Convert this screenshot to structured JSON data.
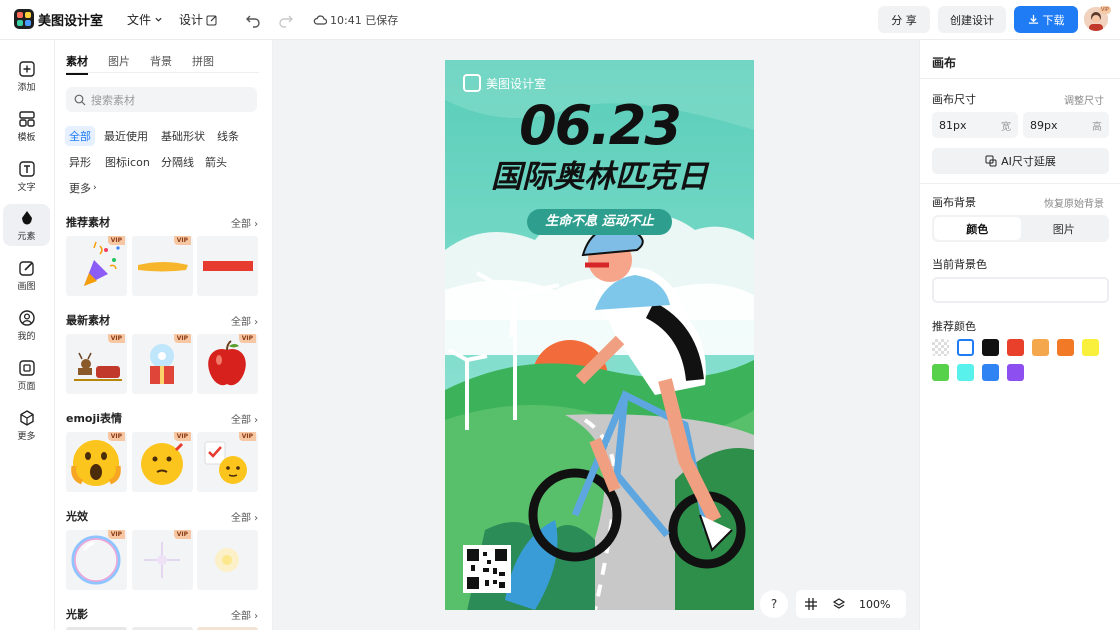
{
  "app": {
    "title": "美图设计室"
  },
  "topbar": {
    "file_menu": "文件",
    "design_menu": "设计",
    "save_status": "10:41 已保存",
    "share": "分 享",
    "create_design": "创建设计",
    "download": "下载",
    "avatar_badge": "VIP"
  },
  "leftnav": {
    "items": [
      {
        "label": "添加",
        "icon": "plus-square-icon"
      },
      {
        "label": "模板",
        "icon": "template-icon"
      },
      {
        "label": "文字",
        "icon": "text-icon"
      },
      {
        "label": "元素",
        "icon": "shapes-icon"
      },
      {
        "label": "画图",
        "icon": "pencil-icon"
      },
      {
        "label": "我的",
        "icon": "user-icon"
      },
      {
        "label": "页面",
        "icon": "page-add-icon"
      },
      {
        "label": "更多",
        "icon": "cube-icon"
      }
    ]
  },
  "panel": {
    "tabs": [
      "素材",
      "图片",
      "背景",
      "拼图"
    ],
    "search_placeholder": "搜索素材",
    "chips": [
      "全部",
      "最近使用",
      "基础形状",
      "线条",
      "异形",
      "图标icon",
      "分隔线",
      "箭头",
      "更多"
    ],
    "sections": [
      {
        "title": "推荐素材",
        "all": "全部"
      },
      {
        "title": "最新素材",
        "all": "全部"
      },
      {
        "title": "emoji表情",
        "all": "全部"
      },
      {
        "title": "光效",
        "all": "全部"
      },
      {
        "title": "光影",
        "all": "全部"
      }
    ],
    "vip": "VIP"
  },
  "canvas": {
    "brand": "美图设计室",
    "date": "06.23",
    "headline": "国际奥林匹克日",
    "slogan": "生命不息 运动不止",
    "colors": {
      "sky": "#6fd3c1",
      "grass": "#3cb35a",
      "sun": "#f0633a"
    }
  },
  "zoom": {
    "help": "?",
    "level": "100%"
  },
  "rpanel": {
    "title": "画布",
    "size_label": "画布尺寸",
    "size_link": "调整尺寸",
    "width_value": "81px",
    "width_unit": "宽",
    "height_value": "89px",
    "height_unit": "高",
    "ai_extend": "AI尺寸延展",
    "bg_label": "画布背景",
    "bg_reset": "恢复原始背景",
    "seg_color": "颜色",
    "seg_image": "图片",
    "current_bg": "当前背景色",
    "recommended": "推荐颜色",
    "swatches": [
      "transparent",
      "#ffffff",
      "#111111",
      "#e8402a",
      "#f4a74c",
      "#f27a26",
      "#f8f03c",
      "#58d14a",
      "#58f1ec",
      "#2f83f3",
      "#8e4ff0"
    ]
  }
}
